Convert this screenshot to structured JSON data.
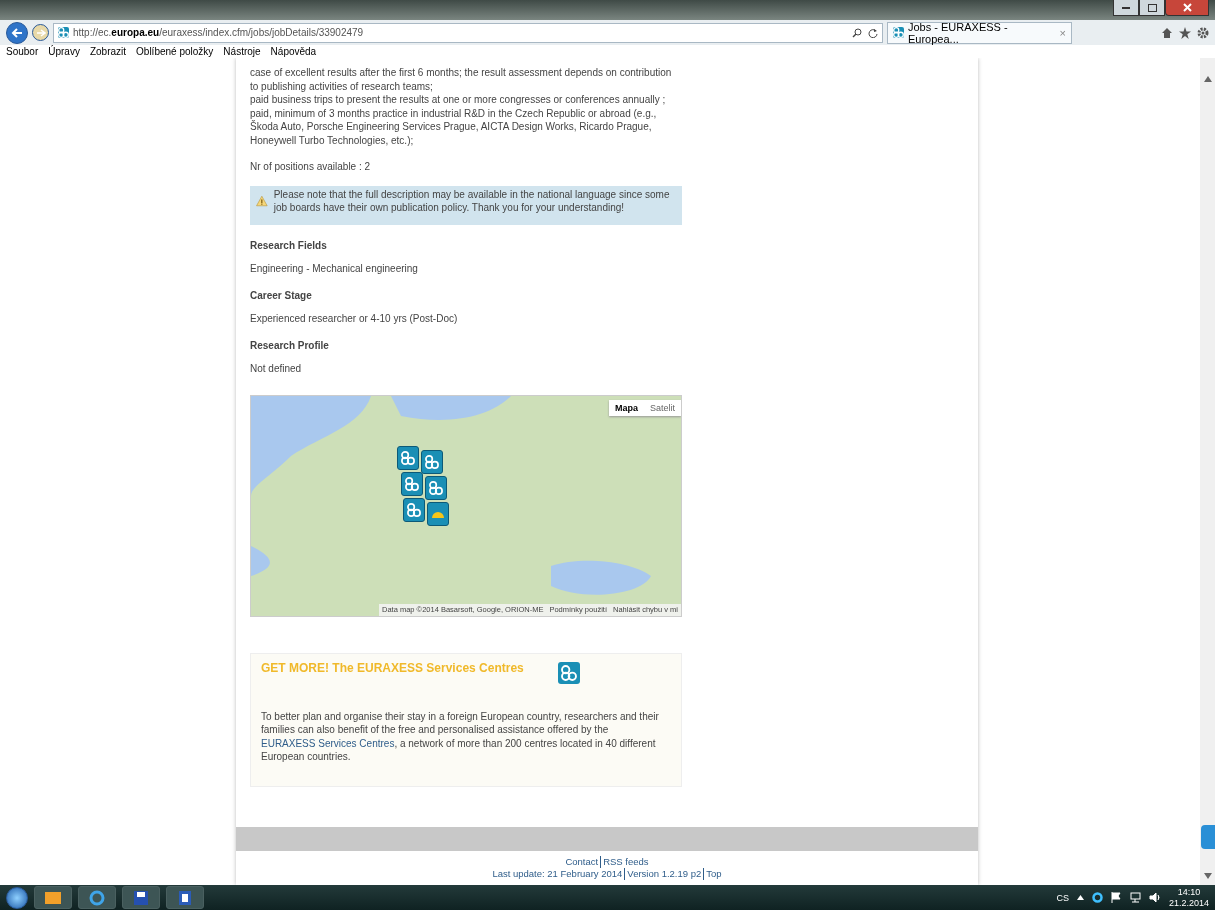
{
  "browser": {
    "url": "http://ec.**europa.eu**/euraxess/index.cfm/jobs/jobDetails/33902479",
    "tab": {
      "title": "Jobs - EURAXESS - Europea...",
      "close": "×"
    },
    "menu": [
      "Soubor",
      "Úpravy",
      "Zobrazit",
      "Oblíbené položky",
      "Nástroje",
      "Nápověda"
    ]
  },
  "job": {
    "benefit_lines": [
      "case of excellent results after the first 6 months; the result assessment depends on contribution to publishing activities of research teams;",
      "paid business trips to present the results at one or more congresses or conferences annually ;",
      "paid, minimum of  3 months practice in industrial R&D in the Czech Republic or abroad (e.g., Škoda Auto, Porsche Engineering Services Prague, AICTA Design Works, Ricardo Prague, Honeywell Turbo Technologies, etc.);"
    ],
    "positions": "Nr of positions available : 2",
    "notice": "Please note that the full description may be available in the national language since some job boards have their own publication policy. Thank you for your understanding!",
    "sections": [
      {
        "heading": "Research Fields",
        "value": "Engineering - Mechanical engineering"
      },
      {
        "heading": "Career Stage",
        "value": "Experienced researcher or 4-10 yrs (Post-Doc)"
      },
      {
        "heading": "Research Profile",
        "value": "Not defined"
      }
    ]
  },
  "map": {
    "map_types": [
      {
        "label": "Mapa",
        "selected": true
      },
      {
        "label": "Satelit",
        "selected": false
      }
    ],
    "attribution": "Data map ©2014 Basarsoft, Google, ORION-ME",
    "terms": "Podmínky použití",
    "report": "Nahlásit chybu v mi"
  },
  "promo": {
    "title": "GET MORE! The EURAXESS Services Centres",
    "text_before": "To better plan and organise their stay in a foreign European country, researchers and their families can also benefit of the free and personalised assistance offered by the ",
    "link": "EURAXESS Services Centres",
    "text_after": ", a network of more than 200 centres located in 40 different European countries."
  },
  "footer": {
    "top_links": [
      "Contact",
      "RSS feeds"
    ],
    "last_update": "Last update: 21 February 2014",
    "version": "Version 1.2.19 p2",
    "top": "Top"
  },
  "taskbar": {
    "language": "CS",
    "time": "14:10",
    "date": "21.2.2014"
  }
}
